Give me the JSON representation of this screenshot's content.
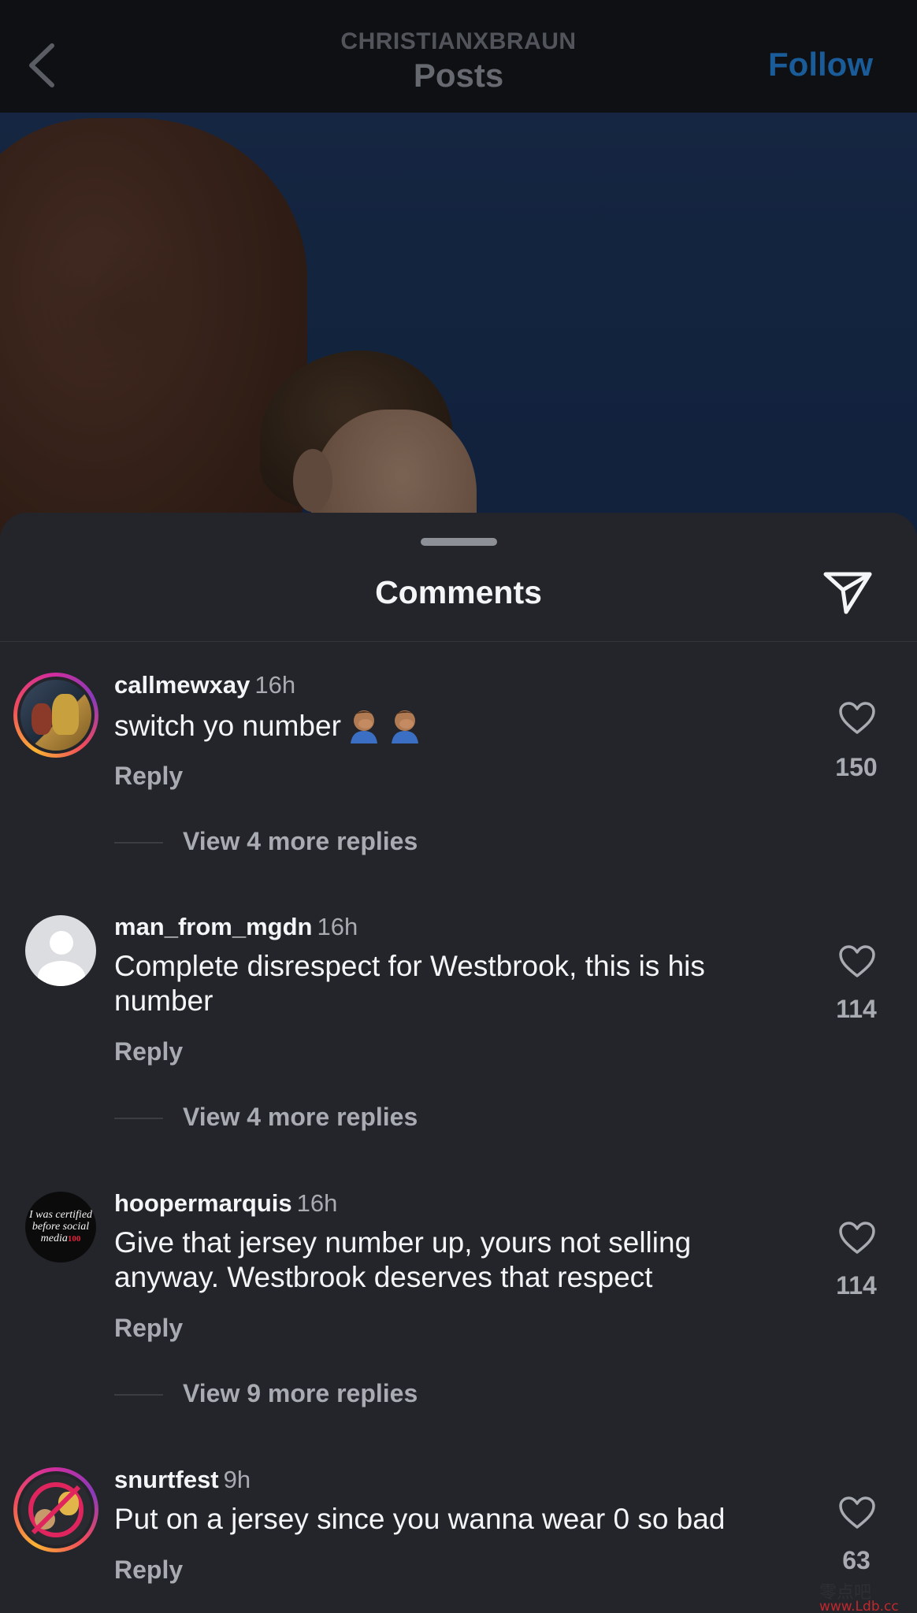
{
  "header": {
    "username": "CHRISTIANXBRAUN",
    "title": "Posts",
    "follow_label": "Follow"
  },
  "sheet": {
    "title": "Comments"
  },
  "icons": {
    "back": "chevron-left-icon",
    "share": "paper-plane-icon",
    "like": "heart-outline-icon",
    "emoji": "person-facepalming-emoji"
  },
  "colors": {
    "background": "#23252a",
    "topbar": "#0f1013",
    "follow": "#1a5c99",
    "text_primary": "#f4f5f7",
    "text_secondary": "#a8abb1"
  },
  "comments": [
    {
      "user": "callmewxay",
      "time": "16h",
      "text": "switch yo number",
      "emoji_count": 2,
      "reply_label": "Reply",
      "likes": "150",
      "view_replies": "View 4 more replies"
    },
    {
      "user": "man_from_mgdn",
      "time": "16h",
      "text": "Complete disrespect for Westbrook, this is his number",
      "reply_label": "Reply",
      "likes": "114",
      "view_replies": "View 4 more replies"
    },
    {
      "user": "hoopermarquis",
      "time": "16h",
      "text": "Give that jersey number up, yours not selling anyway. Westbrook deserves that respect",
      "avatar_text": "I was certified before social media",
      "avatar_badge": "100",
      "reply_label": "Reply",
      "likes": "114",
      "view_replies": "View 9 more replies"
    },
    {
      "user": "snurtfest",
      "time": "9h",
      "text": "Put on a jersey since you wanna wear 0 so bad",
      "reply_label": "Reply",
      "likes": "63"
    }
  ],
  "watermark": {
    "text": "零点吧",
    "url": "www.Ldb.cc"
  }
}
